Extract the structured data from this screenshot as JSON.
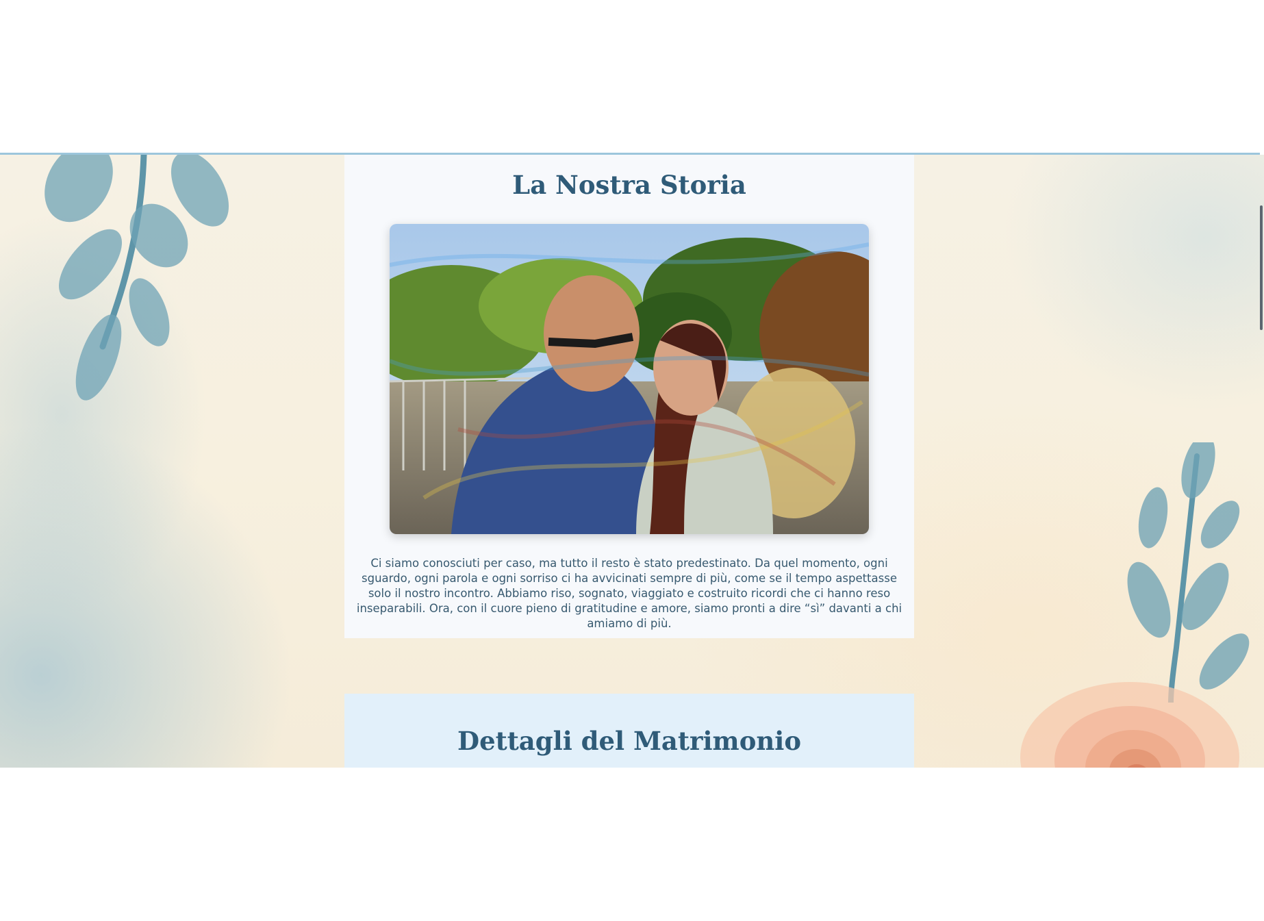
{
  "story": {
    "title": "La Nostra Storia",
    "photo_alt": "",
    "text": "Ci siamo conosciuti per caso, ma tutto il resto è stato predestinato. Da quel momento, ogni sguardo, ogni parola e ogni sorriso ci ha avvicinati sempre di più, come se il tempo aspettasse solo il nostro incontro. Abbiamo riso, sognato, viaggiato e costruito ricordi che ci hanno reso inseparabili. Ora, con il cuore pieno di gratitudine e amore, siamo pronti a dire “sì” davanti a chi amiamo di più."
  },
  "details": {
    "title": "Dettagli del Matrimonio"
  },
  "icons": {
    "leaves_left": "eucalyptus-branch-icon",
    "leaves_right": "eucalyptus-branch-icon",
    "rose": "peach-rose-icon"
  },
  "colors": {
    "heading": "#2f5b78",
    "body_text": "#37596f",
    "story_card_bg": "#f7f9fc",
    "details_card_bg": "#e2f0fa",
    "accent_rule": "#9cc6dc",
    "leaf": "#6fa3b5",
    "rose": "#f2b89c"
  }
}
